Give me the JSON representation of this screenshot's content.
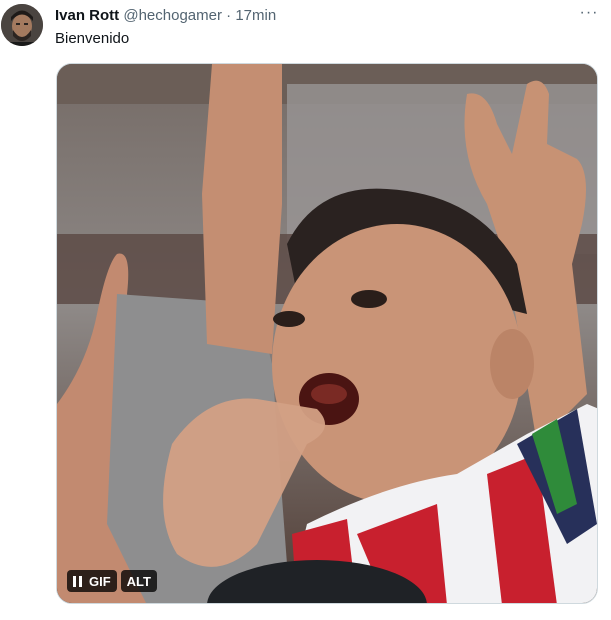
{
  "tweet": {
    "author_name": "Ivan Rott",
    "handle": "@hechogamer",
    "separator": "·",
    "time": "17min",
    "text": "Bienvenido",
    "more_icon": "more-horizontal-icon"
  },
  "media": {
    "badge_label": "GIF",
    "alt_label": "ALT",
    "pause_icon": "pause-icon",
    "colors": {
      "jersey_red": "#c8202e",
      "jersey_white": "#f2f2f4",
      "jersey_navy": "#27305a",
      "skin": "#c89478",
      "background": "#8d8784"
    }
  }
}
